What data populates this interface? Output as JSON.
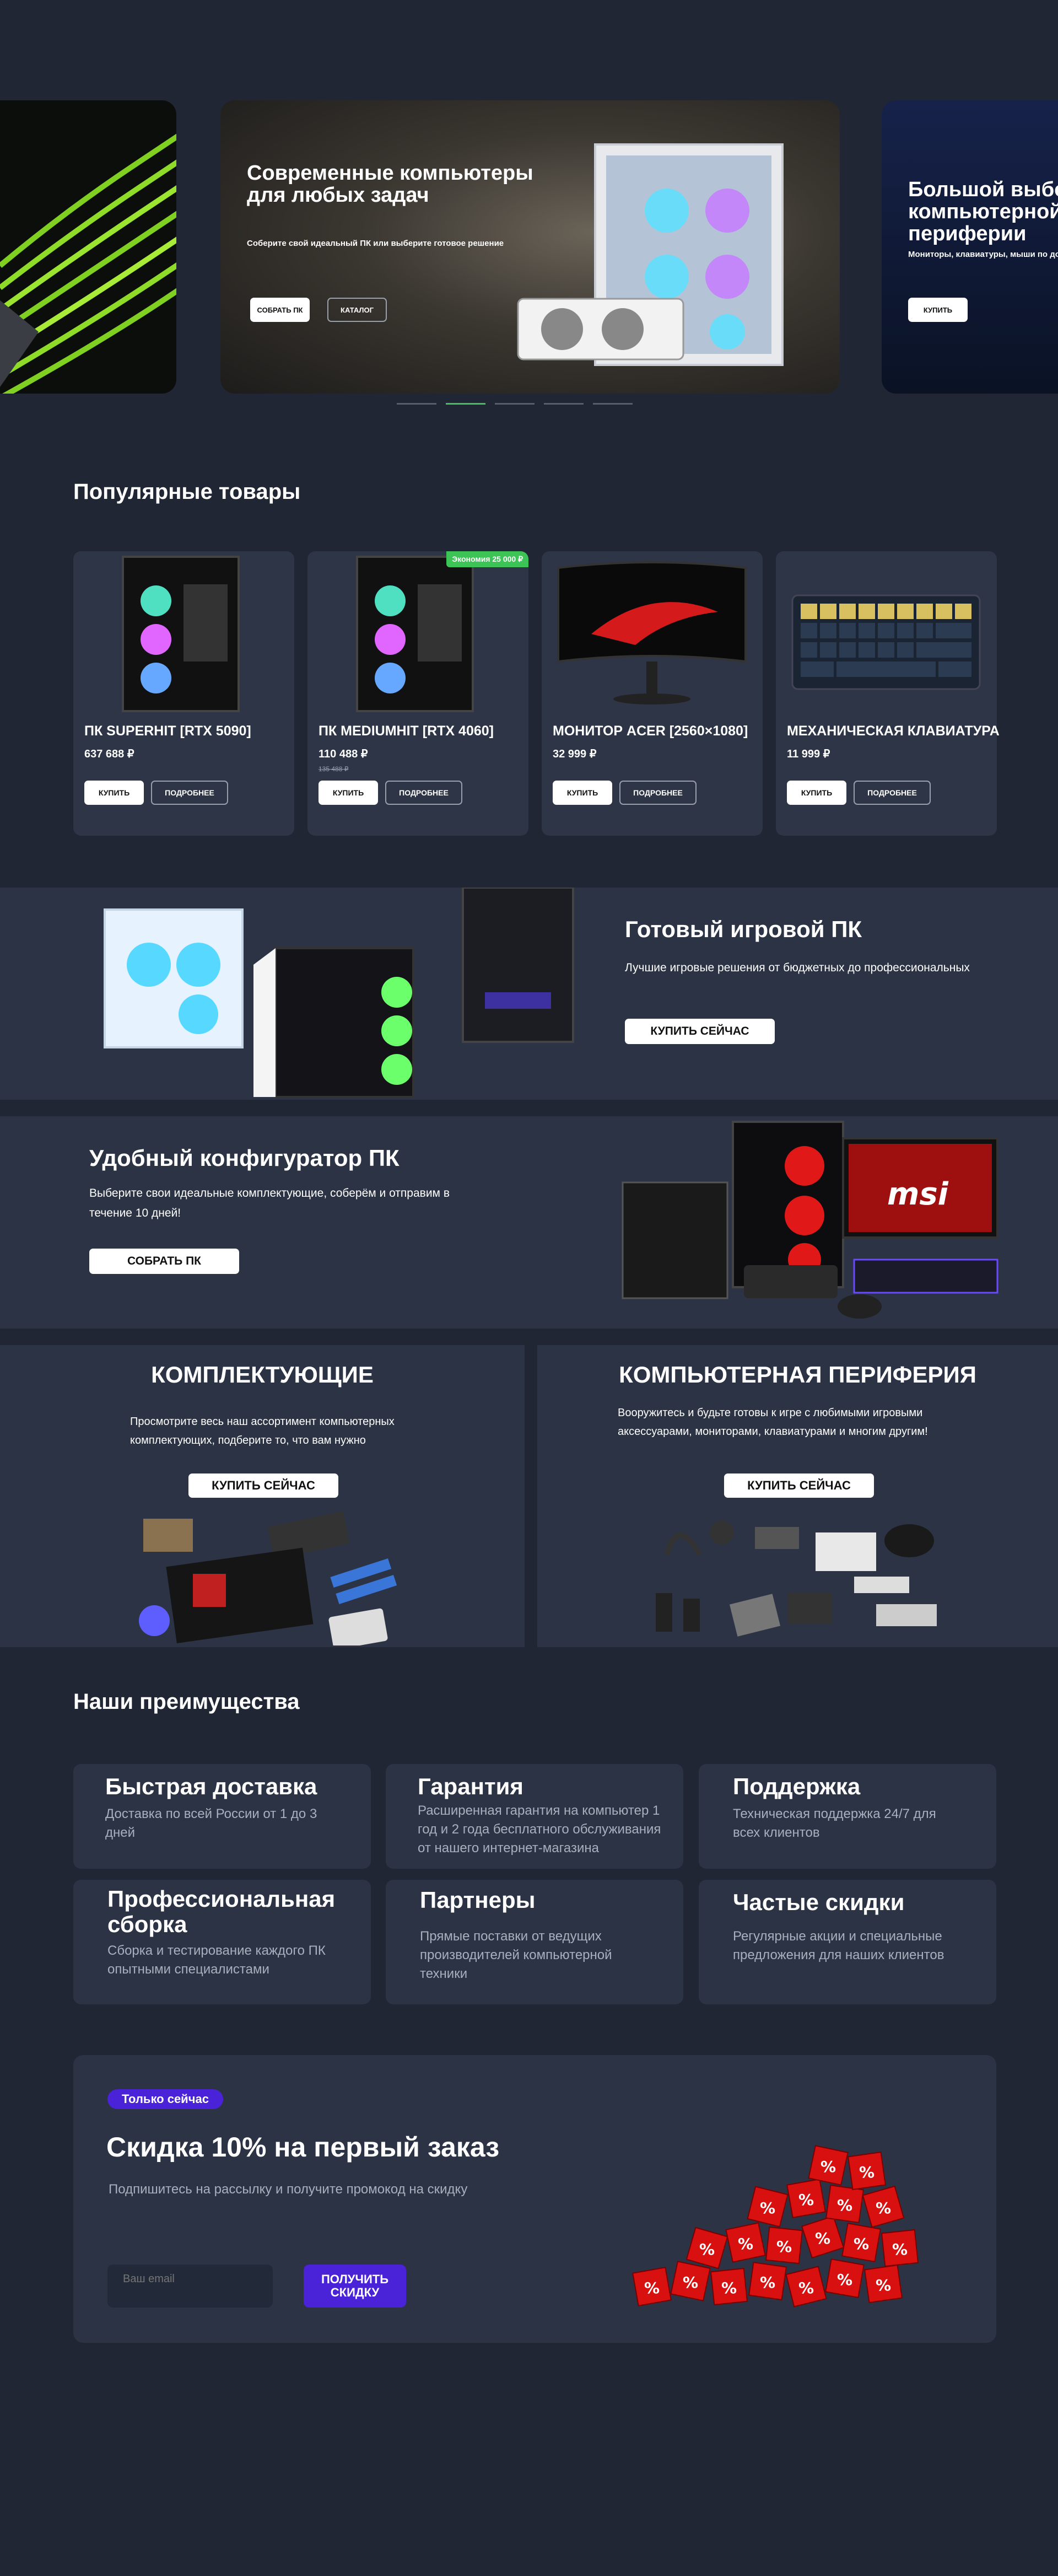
{
  "hero": {
    "slides": [
      {
        "title": "",
        "subtitle": ""
      },
      {
        "title": "Современные компьютеры для любых задач",
        "subtitle": "Соберите свой идеальный ПК или выберите готовое решение",
        "primary": "Собрать ПК",
        "secondary": "Каталог"
      },
      {
        "title": "Большой выбор компьютерной периферии",
        "subtitle": "Мониторы, клавиатуры, мыши по доступной цене",
        "primary": "Купить"
      }
    ],
    "active_dot": 1
  },
  "popular": {
    "title": "Популярные товары",
    "buy_label": "Купить",
    "more_label": "Подробнее",
    "items": [
      {
        "name": "ПК SUPERHIT [RTX 5090]",
        "price": "637 688 ₽",
        "old_price": "",
        "badge": ""
      },
      {
        "name": "ПК MEDIUMHIT [RTX 4060]",
        "price": "110 488 ₽",
        "old_price": "135 488 ₽",
        "badge": "Экономия 25 000 ₽"
      },
      {
        "name": "Монитор ACER [2560×1080]",
        "price": "32 999 ₽",
        "old_price": "",
        "badge": ""
      },
      {
        "name": "Механическая клавиатура",
        "price": "11 999 ₽",
        "old_price": "",
        "badge": ""
      }
    ]
  },
  "gaming_pc": {
    "title": "Готовый игровой ПК",
    "text": "Лучшие игровые решения от бюджетных до профессиональных",
    "button": "Купить сейчас"
  },
  "configurator": {
    "title": "Удобный конфигуратор ПК",
    "text": "Выберите свои идеальные комплектующие, соберём и отправим в течение 10 дней!",
    "button": "Собрать ПК"
  },
  "components": {
    "title": "Комплектующие",
    "text": "Просмотрите весь наш ассортимент компьютерных комплектующих, подберите то, что вам нужно",
    "button": "Купить сейчас"
  },
  "peripherals": {
    "title": "Компьютерная периферия",
    "text": "Вооружитесь и будьте готовы к игре с любимыми игровыми аксессуарами, мониторами, клавиатурами и многим другим!",
    "button": "Купить сейчас"
  },
  "advantages": {
    "title": "Наши преимущества",
    "items": [
      {
        "title": "Быстрая доставка",
        "text": "Доставка по всей России от 1 до 3 дней"
      },
      {
        "title": "Гарантия",
        "text": "Расширенная гарантия на компьютер 1 год и 2 года бесплатного обслуживания от нашего интернет-магазина"
      },
      {
        "title": "Поддержка",
        "text": "Техническая поддержка 24/7 для всех клиентов"
      },
      {
        "title": "Профессиональная сборка",
        "text": "Сборка и тестирование каждого ПК опытными специалистами"
      },
      {
        "title": "Партнеры",
        "text": "Прямые поставки от ведущих производителей компьютерной техники"
      },
      {
        "title": "Частые скидки",
        "text": "Регулярные акции и специальные предложения для наших клиентов"
      }
    ]
  },
  "promo": {
    "badge": "Только сейчас",
    "title": "Скидка 10% на первый заказ",
    "text": "Подпишитесь на рассылку и получите промокод на скидку",
    "email_placeholder": "Ваш email",
    "button": "Получить скидку"
  },
  "colors": {
    "background": "#202634",
    "card": "#2d3547",
    "accent_green": "#3cc456",
    "accent_purple": "#4a22d8"
  }
}
